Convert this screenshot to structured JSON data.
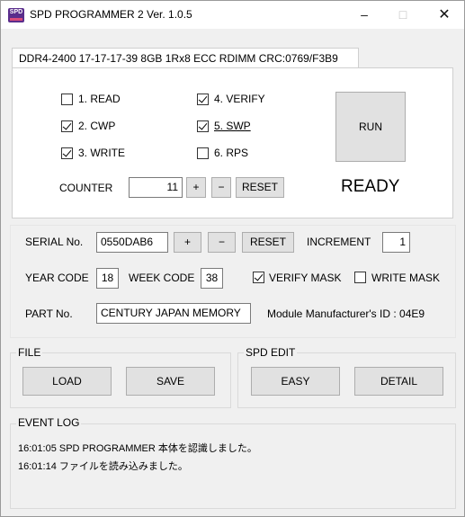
{
  "window": {
    "title": "SPD PROGRAMMER 2 Ver. 1.0.5",
    "icon_text": "SPD",
    "controls": [
      "minimize-icon",
      "maximize-icon",
      "close-icon"
    ]
  },
  "tab": {
    "label": "DDR4-2400 17-17-17-39 8GB 1Rx8 ECC RDIMM CRC:0769/F3B9"
  },
  "ops": {
    "read": {
      "label": "1. READ",
      "checked": false
    },
    "cwp": {
      "label": "2. CWP",
      "checked": true
    },
    "write": {
      "label": "3. WRITE",
      "checked": true
    },
    "verify": {
      "label": "4. VERIFY",
      "checked": true
    },
    "swp": {
      "label": "5. SWP",
      "checked": true
    },
    "rps": {
      "label": "6. RPS",
      "checked": false
    },
    "counter_label": "COUNTER",
    "counter_value": "11",
    "plus": "+",
    "minus": "−",
    "reset": "RESET",
    "run": "RUN",
    "status": "READY"
  },
  "serial": {
    "label": "SERIAL No.",
    "value": "0550DAB6",
    "plus": "+",
    "minus": "−",
    "reset": "RESET",
    "increment_label": "INCREMENT",
    "increment_value": "1"
  },
  "codes": {
    "year_label": "YEAR CODE",
    "year_value": "18",
    "week_label": "WEEK CODE",
    "week_value": "38",
    "verify_mask": {
      "label": "VERIFY MASK",
      "checked": true
    },
    "write_mask": {
      "label": "WRITE MASK",
      "checked": false
    }
  },
  "part": {
    "label": "PART No.",
    "value": "CENTURY JAPAN MEMORY",
    "manufacturer": "Module Manufacturer's ID : 04E9"
  },
  "file_group": {
    "title": "FILE",
    "load": "LOAD",
    "save": "SAVE"
  },
  "spd_group": {
    "title": "SPD EDIT",
    "easy": "EASY",
    "detail": "DETAIL"
  },
  "event_log": {
    "title": "EVENT LOG",
    "lines": [
      "16:01:05 SPD PROGRAMMER 本体を認識しました。",
      "16:01:14 ファイルを読み込みました。"
    ]
  }
}
